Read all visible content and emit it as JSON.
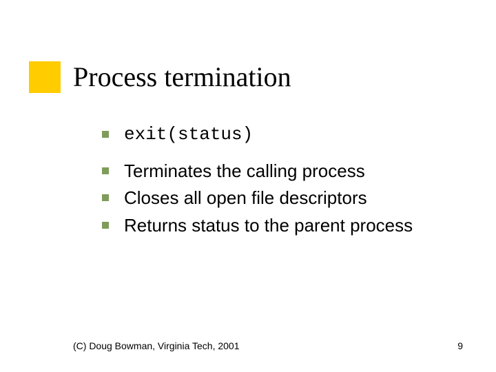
{
  "title": "Process termination",
  "bullets": {
    "item0": "exit(status)",
    "item1": "Terminates the calling process",
    "item2": "Closes all open file descriptors",
    "item3": "Returns status to the parent process"
  },
  "footer": {
    "copyright": "(C) Doug Bowman, Virginia Tech, 2001",
    "page": "9"
  },
  "colors": {
    "accent": "#ffcc00",
    "bullet": "#7f9c5a"
  }
}
